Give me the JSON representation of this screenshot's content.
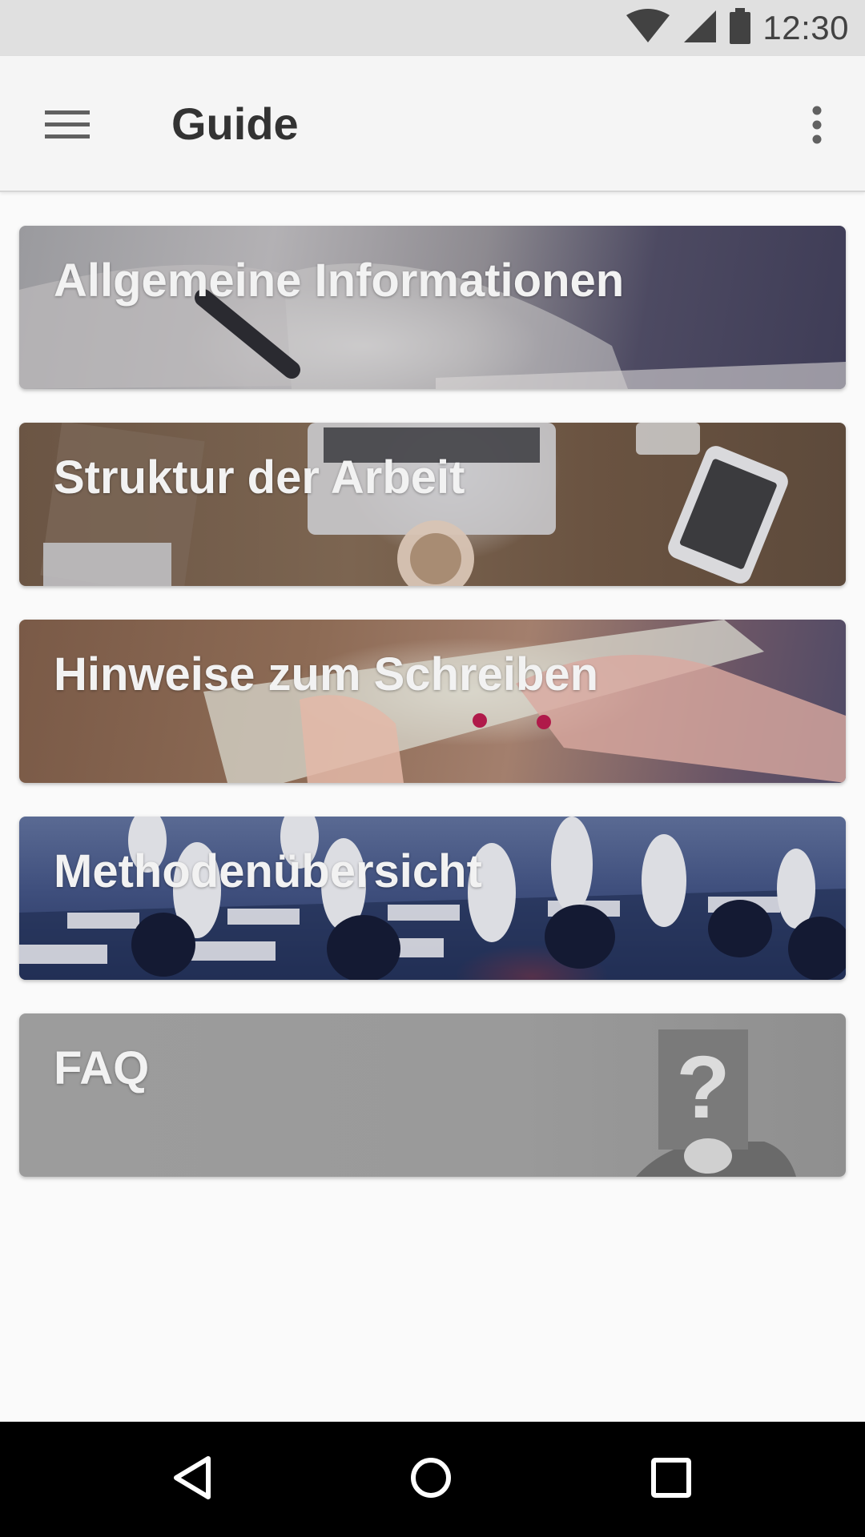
{
  "status_bar": {
    "time": "12:30",
    "icons": [
      "wifi-icon",
      "cellular-signal-icon",
      "battery-icon"
    ]
  },
  "app_bar": {
    "title": "Guide",
    "menu_icon": "hamburger-menu-icon",
    "overflow_icon": "more-vert-icon"
  },
  "cards": [
    {
      "label": "Allgemeine Informationen"
    },
    {
      "label": "Struktur der Arbeit"
    },
    {
      "label": "Hinweise zum Schreiben"
    },
    {
      "label": "Methodenübersicht"
    },
    {
      "label": "FAQ"
    }
  ],
  "nav_bar": {
    "icons": [
      "back-icon",
      "home-icon",
      "recents-icon"
    ]
  },
  "colors": {
    "status_bar_bg": "#e0e0e0",
    "app_bar_bg": "#f5f5f5",
    "title_text": "#333333",
    "page_bg": "#fafafa",
    "nav_bar_bg": "#000000",
    "card_label": "#f2f2f2"
  }
}
